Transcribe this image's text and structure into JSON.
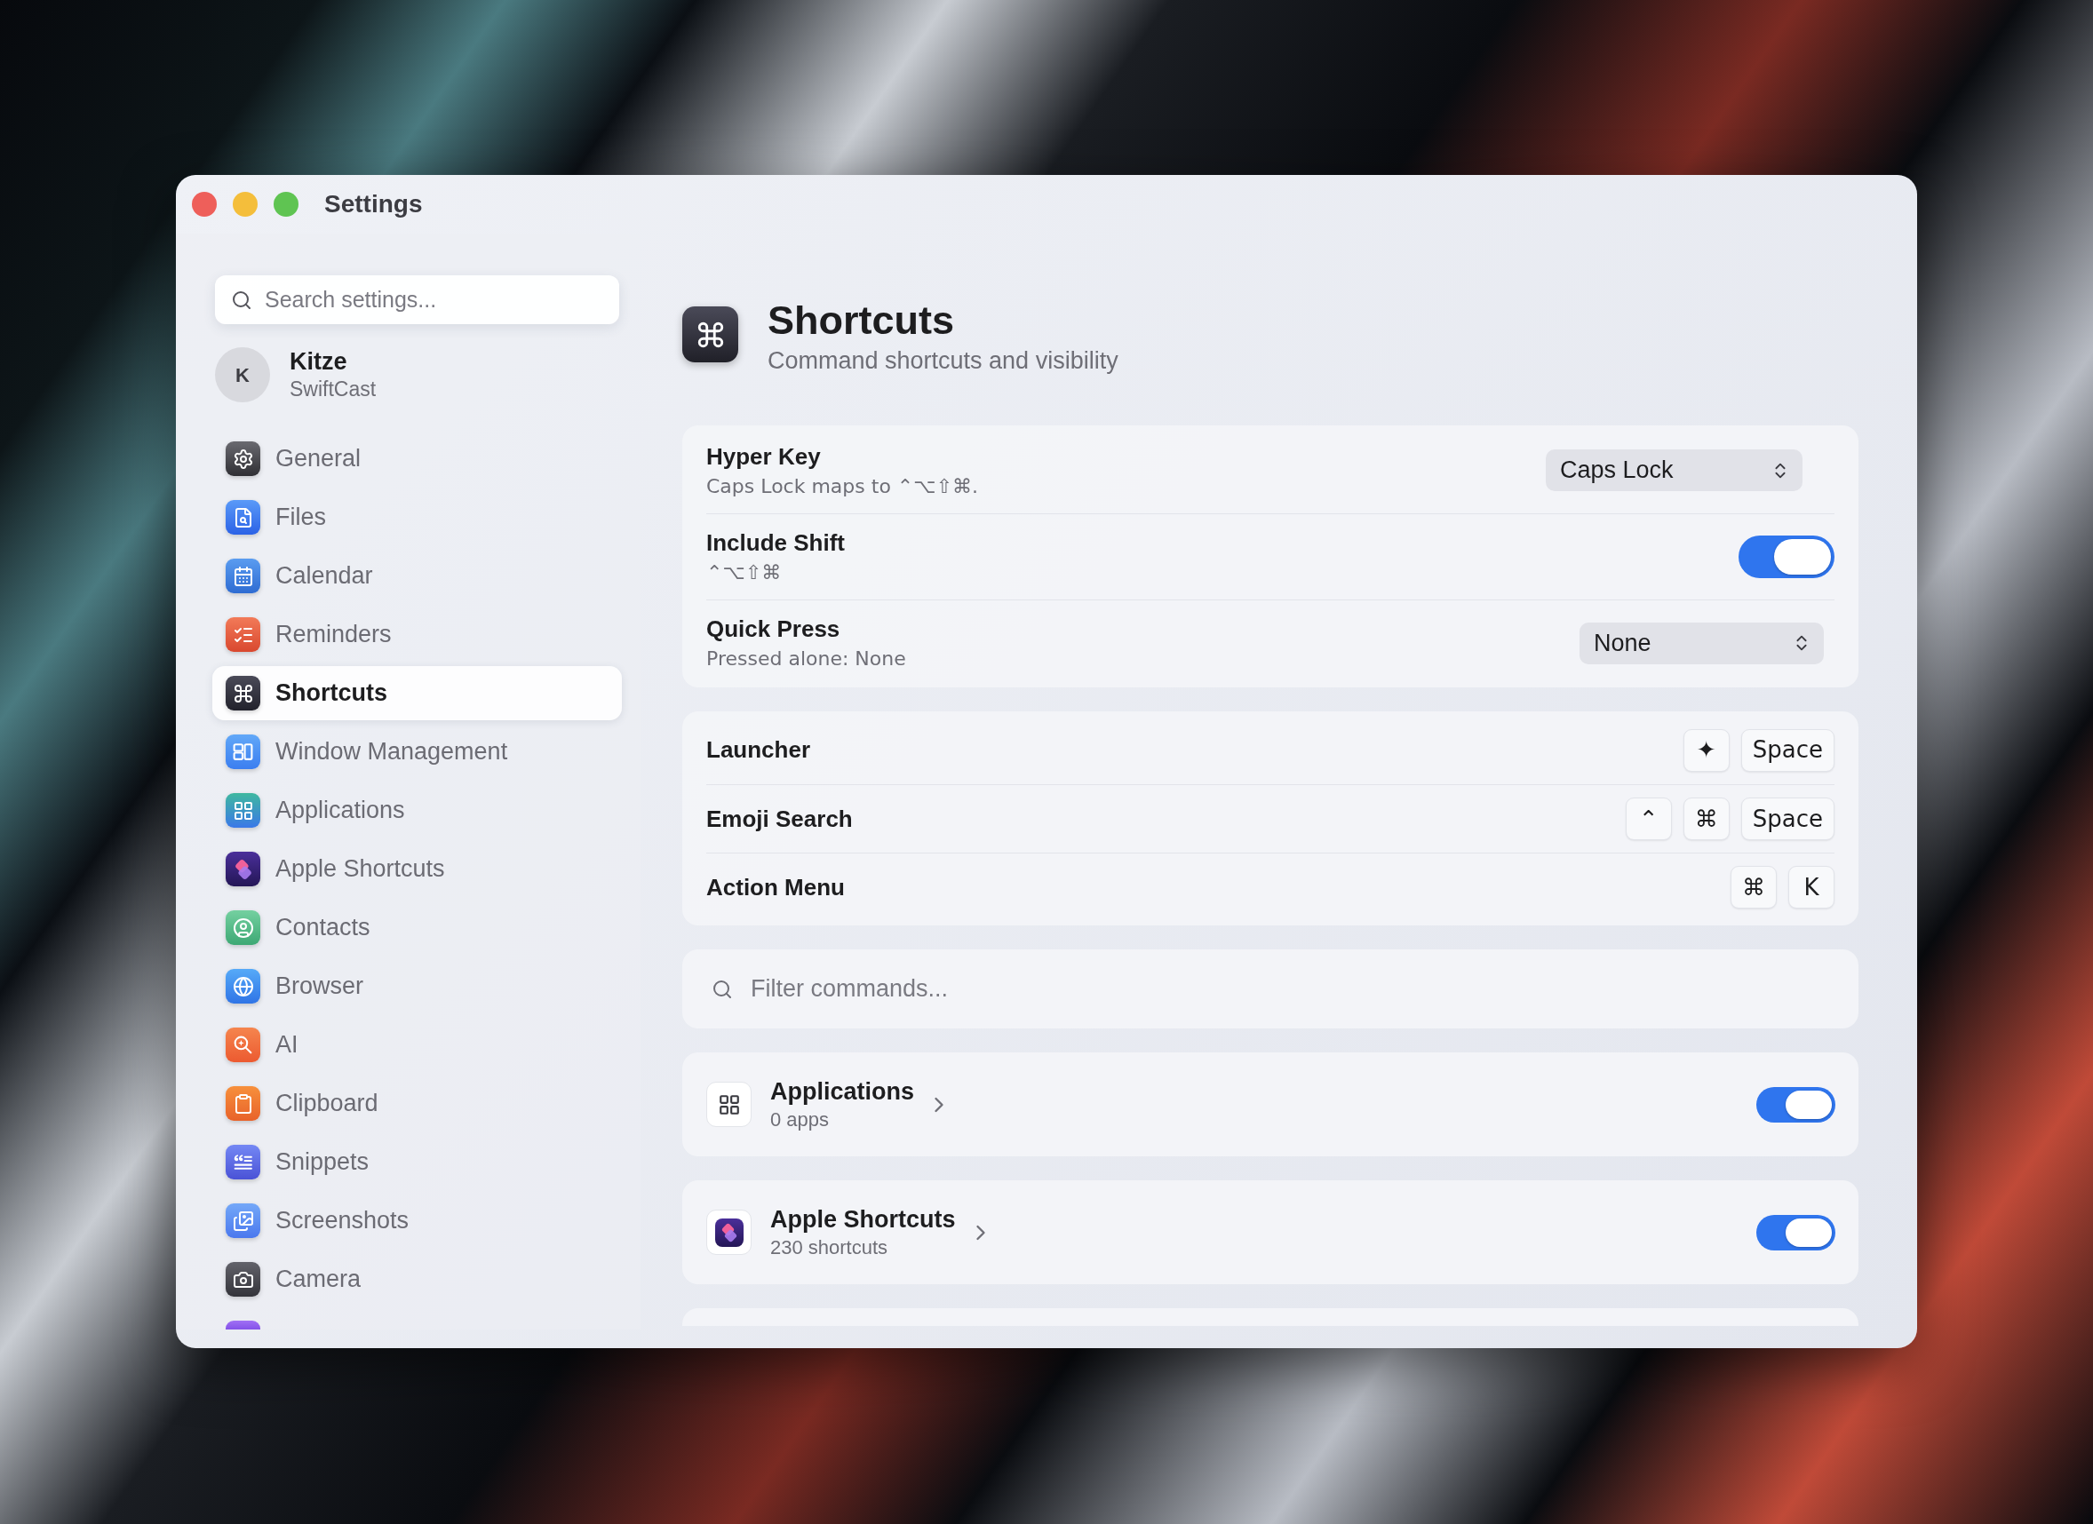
{
  "window": {
    "title": "Settings"
  },
  "sidebar": {
    "search": {
      "placeholder": "Search settings..."
    },
    "account": {
      "initial": "K",
      "name": "Kitze",
      "subtitle": "SwiftCast"
    },
    "items": [
      {
        "label": "General",
        "selected": false
      },
      {
        "label": "Files",
        "selected": false
      },
      {
        "label": "Calendar",
        "selected": false
      },
      {
        "label": "Reminders",
        "selected": false
      },
      {
        "label": "Shortcuts",
        "selected": true
      },
      {
        "label": "Window Management",
        "selected": false
      },
      {
        "label": "Applications",
        "selected": false
      },
      {
        "label": "Apple Shortcuts",
        "selected": false
      },
      {
        "label": "Contacts",
        "selected": false
      },
      {
        "label": "Browser",
        "selected": false
      },
      {
        "label": "AI",
        "selected": false
      },
      {
        "label": "Clipboard",
        "selected": false
      },
      {
        "label": "Snippets",
        "selected": false
      },
      {
        "label": "Screenshots",
        "selected": false
      },
      {
        "label": "Camera",
        "selected": false
      }
    ]
  },
  "header": {
    "title": "Shortcuts",
    "subtitle": "Command shortcuts and visibility"
  },
  "hyper_settings": [
    {
      "kind": "select",
      "title": "Hyper Key",
      "subtitle": "Caps Lock maps to ⌃⌥⇧⌘.",
      "value": "Caps Lock"
    },
    {
      "kind": "toggle",
      "title": "Include Shift",
      "subtitle": "⌃⌥⇧⌘",
      "on": true
    },
    {
      "kind": "select",
      "title": "Quick Press",
      "subtitle": "Pressed alone: None",
      "value": "None"
    }
  ],
  "hotkeys": [
    {
      "title": "Launcher",
      "keys": [
        "✦",
        "Space"
      ]
    },
    {
      "title": "Emoji Search",
      "keys": [
        "⌃",
        "⌘",
        "Space"
      ]
    },
    {
      "title": "Action Menu",
      "keys": [
        "⌘",
        "K"
      ]
    }
  ],
  "filter": {
    "placeholder": "Filter commands..."
  },
  "command_groups": [
    {
      "title": "Applications",
      "subtitle": "0 apps",
      "on": true
    },
    {
      "title": "Apple Shortcuts",
      "subtitle": "230 shortcuts",
      "on": true
    }
  ]
}
